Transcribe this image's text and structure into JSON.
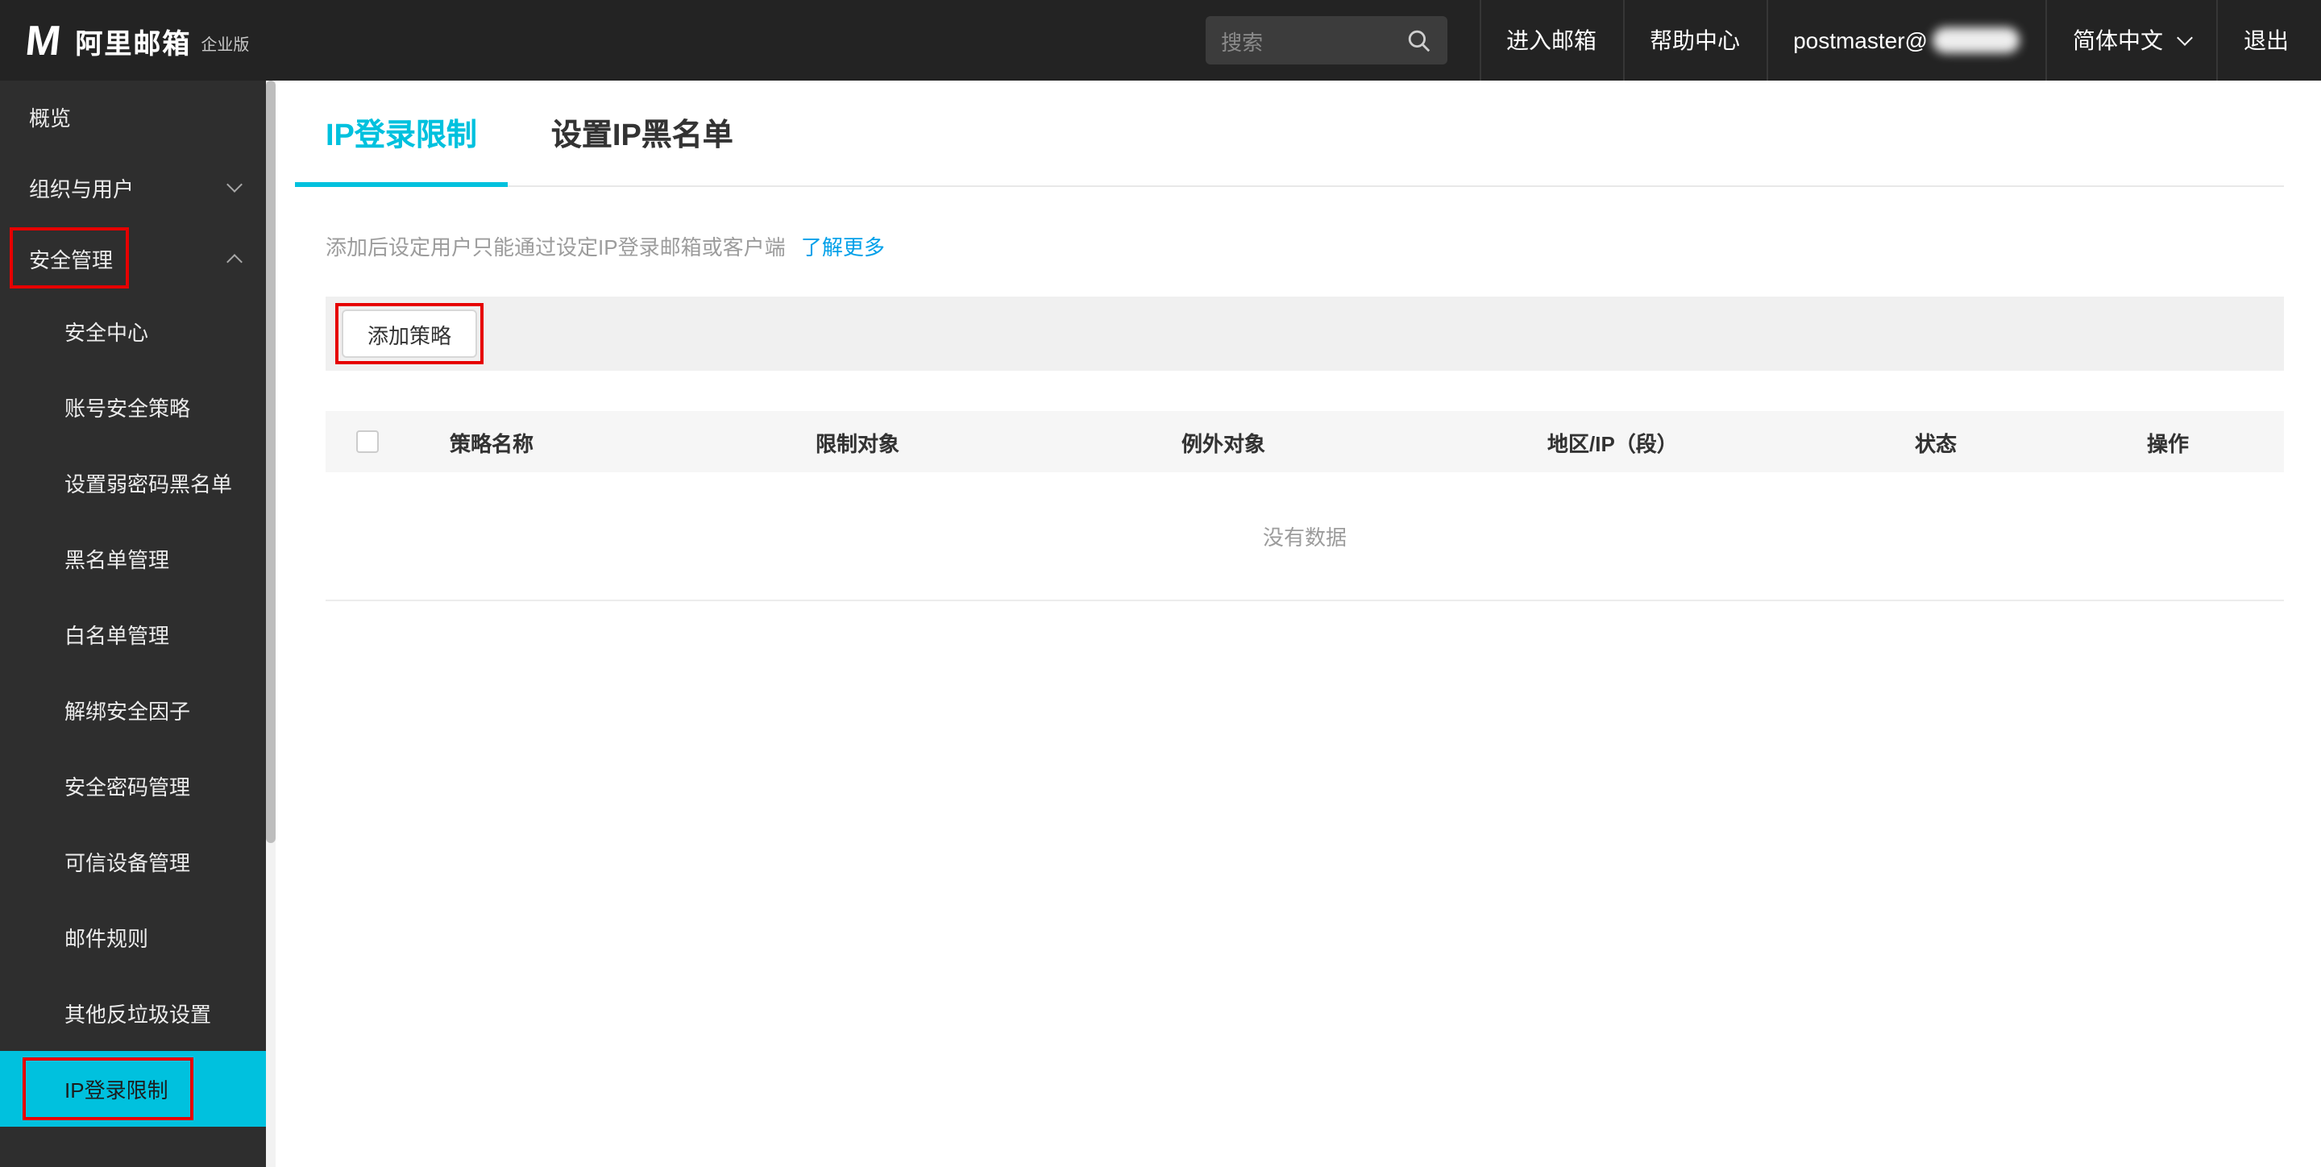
{
  "topbar": {
    "logo_text": "阿里邮箱",
    "logo_badge": "企业版",
    "search_placeholder": "搜索",
    "menu": {
      "enter_mailbox": "进入邮箱",
      "help_center": "帮助中心",
      "account_prefix": "postmaster@",
      "language": "简体中文",
      "logout": "退出"
    }
  },
  "sidebar": {
    "overview": "概览",
    "org_users": "组织与用户",
    "security": "安全管理",
    "sub_items": [
      "安全中心",
      "账号安全策略",
      "设置弱密码黑名单",
      "黑名单管理",
      "白名单管理",
      "解绑安全因子",
      "安全密码管理",
      "可信设备管理",
      "邮件规则",
      "其他反垃圾设置",
      "IP登录限制"
    ]
  },
  "main": {
    "tabs": [
      {
        "label": "IP登录限制"
      },
      {
        "label": "设置IP黑名单"
      }
    ],
    "description": "添加后设定用户只能通过设定IP登录邮箱或客户端",
    "learn_more": "了解更多",
    "add_policy_button": "添加策略",
    "table": {
      "columns": [
        "策略名称",
        "限制对象",
        "例外对象",
        "地区/IP（段）",
        "状态",
        "操作"
      ],
      "empty_text": "没有数据"
    }
  },
  "colors": {
    "accent": "#00c1de",
    "link": "#00a0e9",
    "annotation_red": "#e60000",
    "topbar_bg": "#232323",
    "sidebar_bg": "#2e2e2e"
  }
}
